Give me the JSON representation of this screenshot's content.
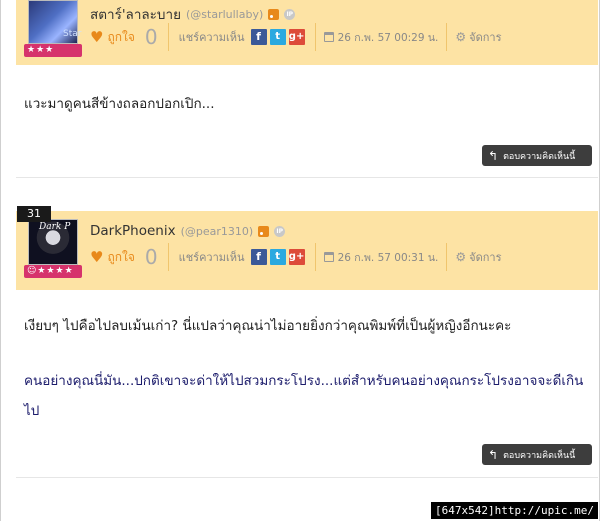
{
  "comments": [
    {
      "username": "สตาร์'ลาละบาย",
      "handle": "(@starlullaby)",
      "avatar_text": "Star",
      "stars": "★★★",
      "like_label": "ถูกใจ",
      "like_count": "0",
      "share_label": "แชร์ความเห็น",
      "date": "26 ก.พ. 57 00:29 น.",
      "manage_label": "จัดการ",
      "text": "แวะมาดูคนสีข้างถลอกปอกเปิก...",
      "reply_label": "ตอบความคิดเห็นนี้"
    },
    {
      "number": "31",
      "username": "DarkPhoenix",
      "handle": "(@pear1310)",
      "avatar_text": "Dark P",
      "stars": "☺★★★★",
      "like_label": "ถูกใจ",
      "like_count": "0",
      "share_label": "แชร์ความเห็น",
      "date": "26 ก.พ. 57 00:31 น.",
      "manage_label": "จัดการ",
      "text": "เงียบๆ ไปคือไปลบเม้นเก่า? นี่แปลว่าคุณน่าไม่อายยิ่งกว่าคุณพิมพ์ที่เป็นผู้หญิงอีกนะคะ",
      "text2": "คนอย่างคุณนี่มัน...ปกติเขาจะด่าให้ไปสวมกระโปรง...แต่สำหรับคนอย่างคุณกระโปรงอาจจะดีเกินไป",
      "reply_label": "ตอบความคิดเห็นนี้"
    }
  ],
  "icons": {
    "social": [
      "facebook-icon",
      "twitter-icon",
      "google-plus-icon"
    ],
    "facebook_glyph": "f",
    "twitter_glyph": "t",
    "googleplus_glyph": "g+",
    "ip_glyph": "IP"
  },
  "watermark": "[647x542]http://upic.me/"
}
